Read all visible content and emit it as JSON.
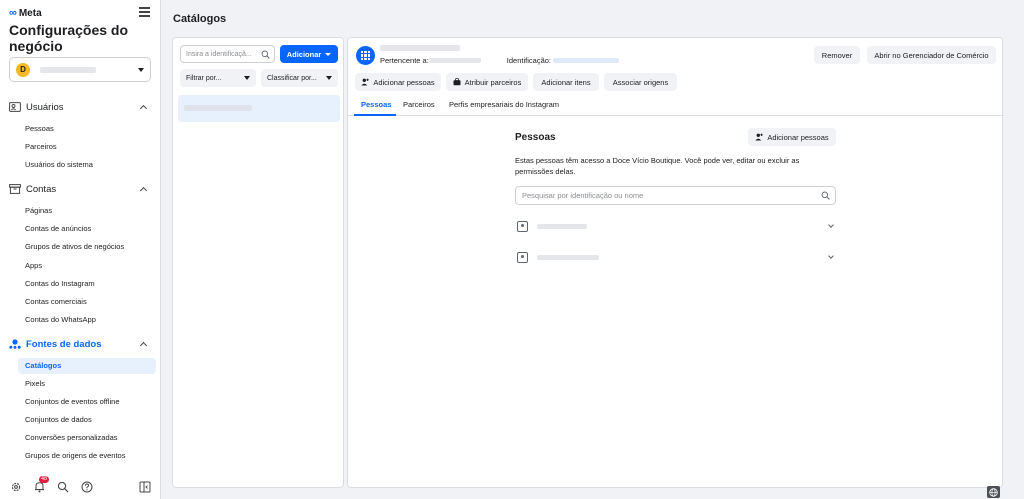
{
  "sidebar": {
    "logo_text": "Meta",
    "logo_glyph": "∞",
    "app_title": "Configurações do negócio",
    "business_initial": "D",
    "sections": [
      {
        "label": "Usuários",
        "items": [
          "Pessoas",
          "Parceiros",
          "Usuários do sistema"
        ]
      },
      {
        "label": "Contas",
        "items": [
          "Páginas",
          "Contas de anúncios",
          "Grupos de ativos de negócios",
          "Apps",
          "Contas do Instagram",
          "Contas comerciais",
          "Contas do WhatsApp"
        ]
      },
      {
        "label": "Fontes de dados",
        "items": [
          "Catálogos",
          "Pixels",
          "Conjuntos de eventos offline",
          "Conjuntos de dados",
          "Conversões personalizadas",
          "Grupos de origens de eventos"
        ]
      }
    ],
    "notification_count": "48"
  },
  "page": {
    "title": "Catálogos"
  },
  "left_panel": {
    "search_placeholder": "Insira a identificaçã...",
    "add_button": "Adicionar",
    "filter_button": "Filtrar por...",
    "sort_button": "Classificar por..."
  },
  "detail": {
    "owner_label": "Pertencente a:",
    "id_label": "Identificação:",
    "remove_button": "Remover",
    "open_commerce_button": "Abrir no Gerenciador de Comércio",
    "actions": [
      "Adicionar pessoas",
      "Atribuir parceiros",
      "Adicionar itens",
      "Associar origens"
    ],
    "tabs": [
      "Pessoas",
      "Parceiros",
      "Perfis empresariais do Instagram"
    ],
    "people": {
      "title": "Pessoas",
      "add_button": "Adicionar pessoas",
      "description": "Estas pessoas têm acesso a Doce Vício Boutique. Você pode ver, editar ou excluir as permissões delas.",
      "search_placeholder": "Pesquisar por identificação ou nome"
    }
  },
  "colors": {
    "accent": "#0866ff",
    "selected_bg": "#e7f0fd",
    "badge": "#e41e3f"
  }
}
